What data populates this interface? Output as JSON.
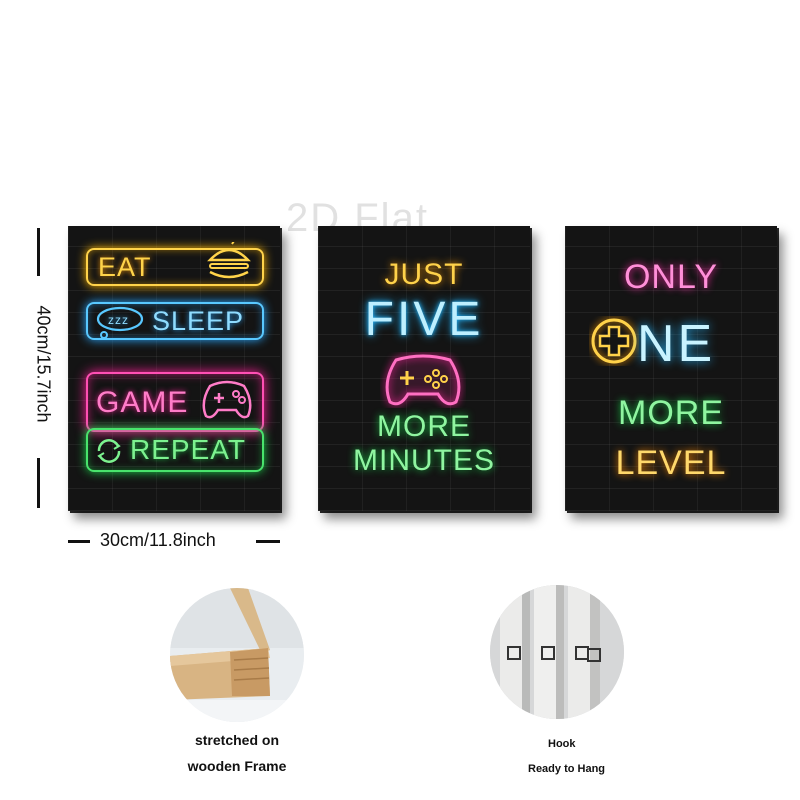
{
  "watermark": "2D Flat",
  "dimensions": {
    "height_label": "40cm/15.7inch",
    "width_label": "30cm/11.8inch"
  },
  "panels": [
    {
      "lines": [
        "EAT",
        "SLEEP",
        "GAME",
        "REPEAT"
      ],
      "icons": [
        "burger-icon",
        "sleep-bubble-icon",
        "gamepad-icon",
        "repeat-arrows-icon"
      ],
      "colors": [
        "#ffd34a",
        "#59c8ff",
        "#ff4fb4",
        "#49e36c"
      ]
    },
    {
      "lines": [
        "JUST",
        "FIVE",
        "MORE",
        "MINUTES"
      ],
      "icons": [
        "gamepad-icon"
      ],
      "colors": [
        "#ffd24a",
        "#21b6ff",
        "#ff4fb4",
        "#16d048"
      ]
    },
    {
      "lines": [
        "ONLY",
        "NE",
        "MORE",
        "LEVEL"
      ],
      "icons": [
        "dpad-icon"
      ],
      "colors": [
        "#ff2aa8",
        "#26b8ff",
        "#16d048",
        "#ff8a00"
      ]
    }
  ],
  "features": [
    {
      "caption_lines": [
        "stretched on",
        "wooden Frame"
      ],
      "image": "wooden-frame-corner"
    },
    {
      "caption_lines": [
        "Hook",
        "Ready to Hang"
      ],
      "image": "hanging-hooks"
    }
  ]
}
